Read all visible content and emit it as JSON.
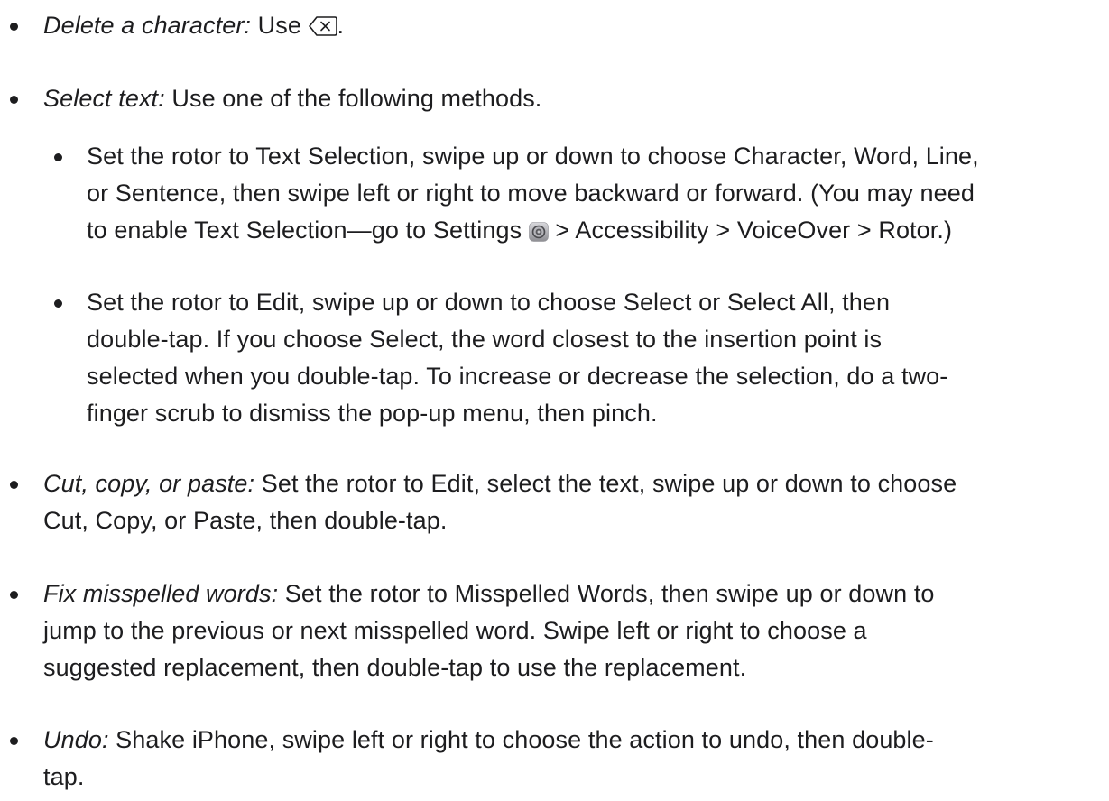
{
  "items": [
    {
      "term": "Delete a character:",
      "text_before_icon": " Use ",
      "icon": "delete-key-icon",
      "text_after_icon": "."
    },
    {
      "term": "Select text:",
      "text": " Use one of the following methods.",
      "subitems": [
        {
          "line1": "Set the rotor to Text Selection, swipe up or down to choose Character, Word, Line,",
          "line2": "or Sentence, then swipe left or right to move backward or forward. (You may need",
          "line3_before_icon": "to enable Text Selection—go to Settings ",
          "icon": "settings-gear-icon",
          "line3_after_icon": " > Accessibility > VoiceOver > Rotor.)"
        },
        {
          "line1": "Set the rotor to Edit, swipe up or down to choose Select or Select All, then",
          "line2": "double-tap. If you choose Select, the word closest to the insertion point is",
          "line3": "selected when you double-tap. To increase or decrease the selection, do a two-",
          "line4": "finger scrub to dismiss the pop-up menu, then pinch."
        }
      ]
    },
    {
      "term": "Cut, copy, or paste:",
      "line1": " Set the rotor to Edit, select the text, swipe up or down to choose",
      "line2": "Cut, Copy, or Paste, then double-tap."
    },
    {
      "term": "Fix misspelled words:",
      "line1": " Set the rotor to Misspelled Words, then swipe up or down to",
      "line2": "jump to the previous or next misspelled word. Swipe left or right to choose a",
      "line3": "suggested replacement, then double-tap to use the replacement."
    },
    {
      "term": "Undo:",
      "line1": " Shake iPhone, swipe left or right to choose the action to undo, then double-",
      "line2": "tap."
    }
  ]
}
